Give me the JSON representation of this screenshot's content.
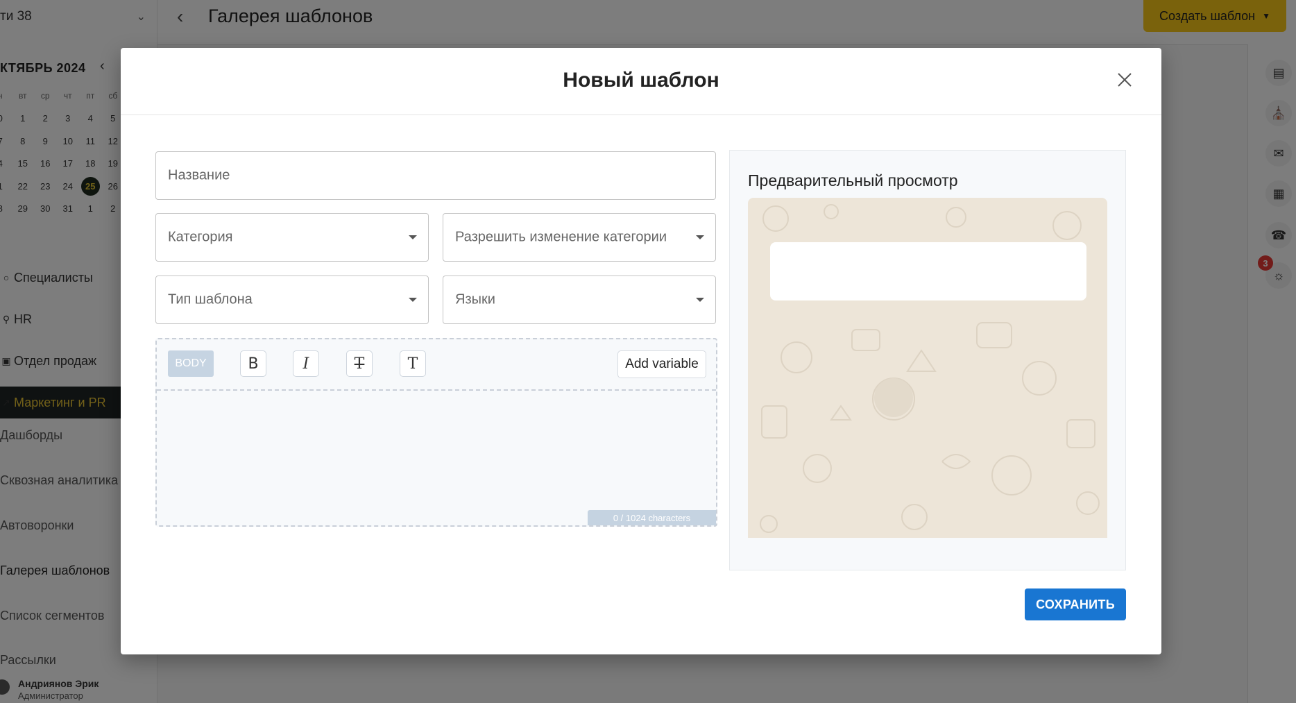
{
  "app": {
    "workspace": "ти 38",
    "calendar": {
      "month": "КТЯБРЬ 2024",
      "weekdays": [
        "н",
        "вт",
        "ср",
        "чт",
        "пт",
        "сб"
      ],
      "weeks": [
        [
          "0",
          "1",
          "2",
          "3",
          "4",
          "5"
        ],
        [
          "7",
          "8",
          "9",
          "10",
          "11",
          "12"
        ],
        [
          "4",
          "15",
          "16",
          "17",
          "18",
          "19"
        ],
        [
          "1",
          "22",
          "23",
          "24",
          "25",
          "26"
        ],
        [
          "8",
          "29",
          "30",
          "31",
          "1",
          "2"
        ]
      ],
      "today": "25"
    },
    "nav": [
      {
        "label": "Специалисты",
        "icon": "user-icon"
      },
      {
        "label": "HR",
        "icon": "search-icon"
      },
      {
        "label": "Отдел продаж",
        "icon": "briefcase-icon"
      },
      {
        "label": "Маркетинг и PR",
        "icon": "chart-icon"
      }
    ],
    "subnav": [
      "Дашборды",
      "Сквозная аналитика",
      "Автоворонки",
      "Галерея шаблонов",
      "Список сегментов",
      "Рассылки"
    ],
    "user": {
      "name": "Андриянов Эрик",
      "role": "Администратор"
    },
    "page_title": "Галерея шаблонов",
    "create_button": "Создать шаблон",
    "right_icons": [
      "document-icon",
      "bank-icon",
      "chat-icon",
      "board-icon",
      "headset-icon",
      "messenger-icon"
    ],
    "notification_count": "3"
  },
  "modal": {
    "title": "Новый шаблон",
    "fields": {
      "name_placeholder": "Название",
      "category_placeholder": "Категория",
      "allow_category_change_placeholder": "Разрешить изменение категории",
      "template_type_placeholder": "Тип шаблона",
      "languages_placeholder": "Языки"
    },
    "editor": {
      "body_label": "BODY",
      "toolbar_icons": [
        "bold-icon",
        "italic-icon",
        "strikethrough-icon",
        "text-format-icon"
      ],
      "add_variable": "Add variable",
      "counter": "0 / 1024 characters"
    },
    "preview": {
      "title": "Предварительный просмотр"
    },
    "save_button": "СОХРАНИТЬ"
  }
}
